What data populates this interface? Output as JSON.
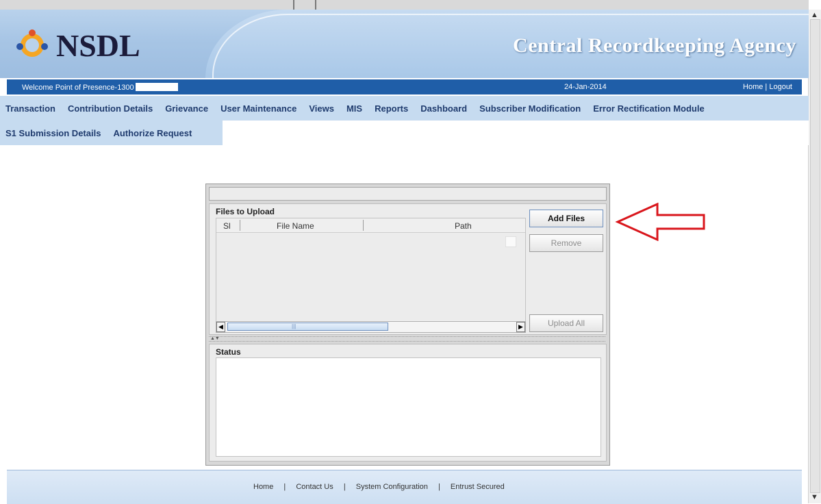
{
  "header": {
    "logo_text": "NSDL",
    "agency_title": "Central Recordkeeping Agency"
  },
  "welcome_bar": {
    "welcome_text": "Welcome Point of Presence-1300",
    "date": "24-Jan-2014",
    "home_link": "Home",
    "links_separator": "|",
    "logout_link": "Logout"
  },
  "menu": {
    "row1": [
      "Transaction",
      "Contribution Details",
      "Grievance",
      "User Maintenance",
      "Views",
      "MIS",
      "Reports",
      "Dashboard",
      "Subscriber Modification",
      "Error Rectification Module"
    ],
    "row2": [
      "S1 Submission Details",
      "Authorize Request"
    ]
  },
  "upload_panel": {
    "files_label": "Files to Upload",
    "columns": [
      "Sl",
      "File Name",
      "Path"
    ],
    "add_files_button": "Add Files",
    "remove_button": "Remove",
    "upload_all_button": "Upload All",
    "status_label": "Status"
  },
  "footer": {
    "links": [
      "Home",
      "Contact Us",
      "System Configuration",
      "Entrust Secured"
    ],
    "separator": "|"
  },
  "colors": {
    "welcome_bar": "#1f5ea8",
    "menu_bg": "#c6dbf0",
    "menu_text": "#1f3b6e",
    "annotation_arrow": "#d9161c"
  }
}
